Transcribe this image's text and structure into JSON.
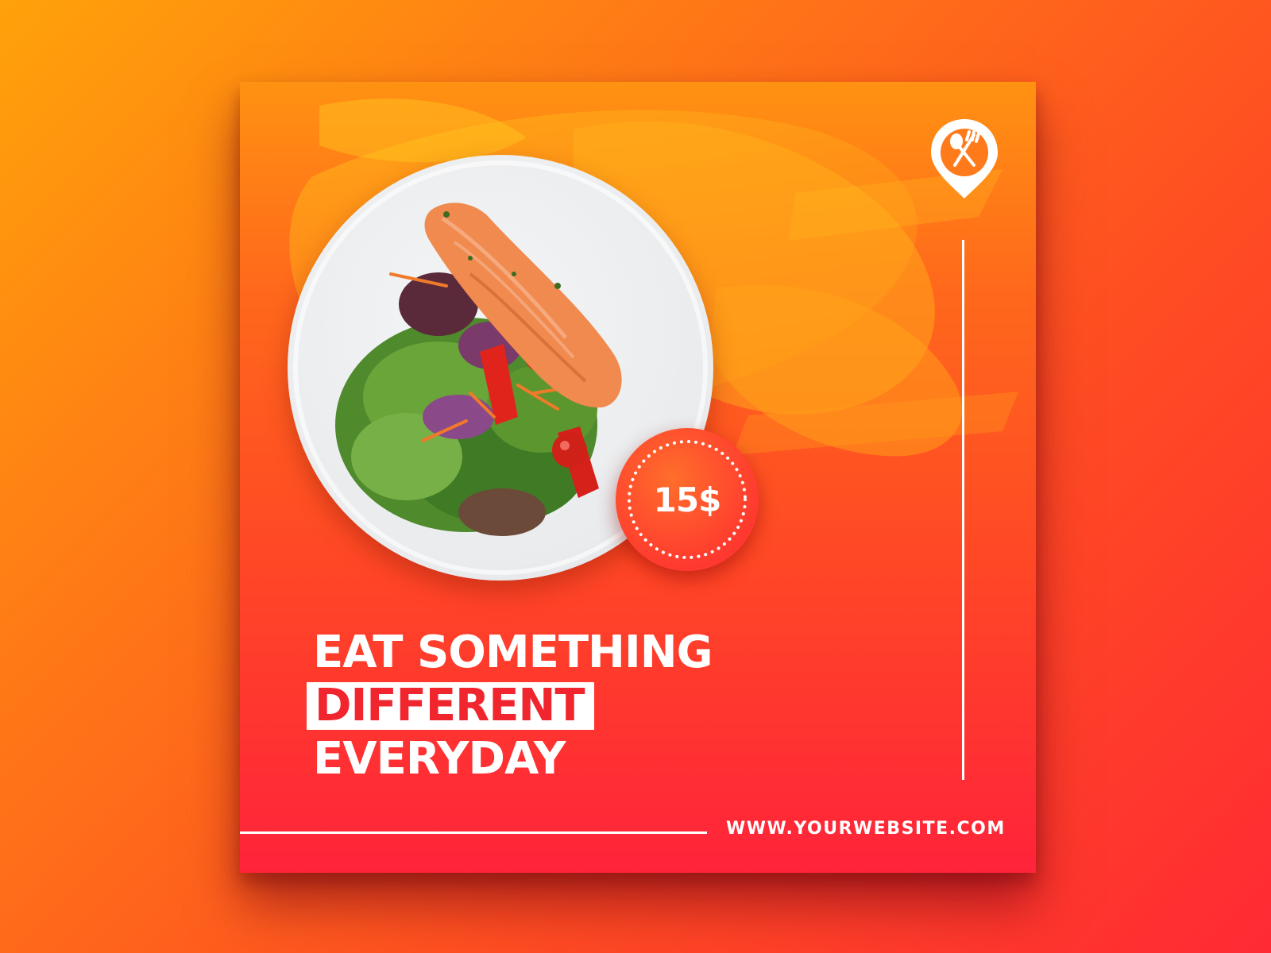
{
  "banner": {
    "price": "15$",
    "headline": {
      "line1": "EAT SOMETHING",
      "line2": "DIFFERENT",
      "line3": "EVERYDAY"
    },
    "website": "WWW.YOURWEBSITE.COM",
    "icon": "location-pin-cutlery-icon",
    "image": "salmon-salad-plate",
    "colors": {
      "accent_orange": "#ff9212",
      "accent_red": "#ff233a",
      "text": "#ffffff"
    }
  }
}
